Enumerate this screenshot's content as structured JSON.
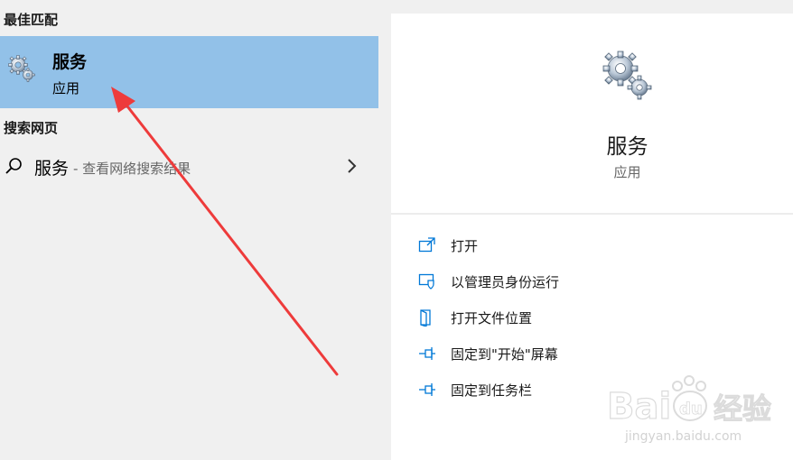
{
  "left": {
    "best_match_title": "最佳匹配",
    "best_match": {
      "name": "服务",
      "type": "应用",
      "icon": "gears-icon"
    },
    "web_title": "搜索网页",
    "web_item": {
      "query": "服务",
      "suffix": "- 查看网络搜索结果",
      "icon": "search-icon"
    }
  },
  "right": {
    "app_name": "服务",
    "app_type": "应用",
    "actions": [
      {
        "label": "打开",
        "icon": "open-icon"
      },
      {
        "label": "以管理员身份运行",
        "icon": "shield-icon"
      },
      {
        "label": "打开文件位置",
        "icon": "folder-icon"
      },
      {
        "label": "固定到\"开始\"屏幕",
        "icon": "pin-icon"
      },
      {
        "label": "固定到任务栏",
        "icon": "pin-icon"
      }
    ]
  },
  "watermark": {
    "brand_main": "Bai",
    "brand_paw": "du",
    "brand_cn": "经验",
    "url": "jingyan.baidu.com"
  },
  "colors": {
    "selection": "#92c1e8",
    "accent": "#0078d7",
    "arrow": "#ee3b3b"
  }
}
